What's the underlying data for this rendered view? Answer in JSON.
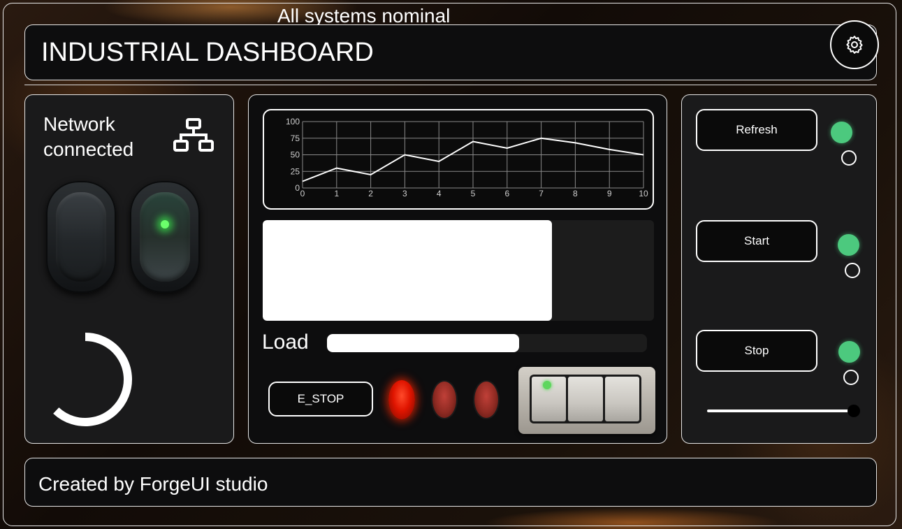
{
  "status": {
    "text": "All systems nominal"
  },
  "header": {
    "title": "INDUSTRIAL DASHBOARD",
    "settings_icon": "gear-icon"
  },
  "network": {
    "label": "Network connected",
    "icon": "network-icon"
  },
  "rockers": [
    {
      "state": "off"
    },
    {
      "state": "on"
    }
  ],
  "spinner": {
    "progress": 0.62
  },
  "chart_data": {
    "type": "line",
    "x": [
      0,
      1,
      2,
      3,
      4,
      5,
      6,
      7,
      8,
      9,
      10
    ],
    "series": [
      {
        "values": [
          10,
          30,
          20,
          50,
          40,
          70,
          60,
          75,
          68,
          58,
          50
        ]
      }
    ],
    "xlim": [
      0,
      10
    ],
    "ylim": [
      0,
      100
    ],
    "x_ticks": [
      "0",
      "1",
      "2",
      "3",
      "4",
      "5",
      "6",
      "7",
      "8",
      "9",
      "10"
    ],
    "y_ticks": [
      "0",
      "25",
      "50",
      "75",
      "100"
    ],
    "grid": true,
    "colors": {
      "line": "#ffffff",
      "grid": "#8a8a8a"
    }
  },
  "level_bar": {
    "fraction": 0.74
  },
  "load": {
    "label": "Load",
    "fraction": 0.6
  },
  "controls": {
    "estop_label": "E_STOP",
    "indicator_leds": [
      {
        "state": "on",
        "color": "#ff2a00"
      },
      {
        "state": "off",
        "color": "#8e2a22"
      },
      {
        "state": "off",
        "color": "#8e2a22"
      }
    ],
    "rocker_switch_block": {
      "keys": 3,
      "active_led": "green"
    }
  },
  "actions": [
    {
      "label": "Refresh",
      "status_color": "#4cc97e"
    },
    {
      "label": "Start",
      "status_color": "#4cc97e"
    },
    {
      "label": "Stop",
      "status_color": "#4cc97e"
    }
  ],
  "slider": {
    "fraction": 1.0
  },
  "footer": {
    "text": "Created by ForgeUI studio"
  }
}
